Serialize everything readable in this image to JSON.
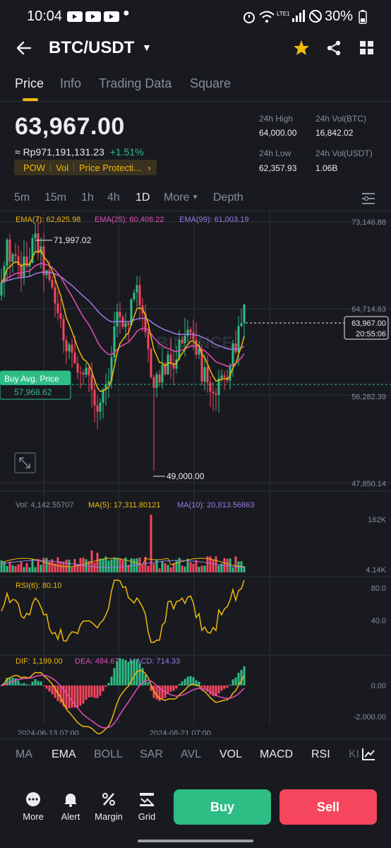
{
  "status_bar": {
    "time": "10:04",
    "battery": "30%",
    "network": "LTE1"
  },
  "header": {
    "pair": "BTC/USDT"
  },
  "tabs": [
    "Price",
    "Info",
    "Trading Data",
    "Square"
  ],
  "ticker": {
    "last_price": "63,967.00",
    "fiat_price": "≈ Rp971,191,131.23",
    "change": "+1.51%",
    "badges": [
      "POW",
      "Vol",
      "Price Protecti..."
    ],
    "high_label": "24h High",
    "high": "64,000.00",
    "low_label": "24h Low",
    "low": "62,357.93",
    "vol_btc_label": "24h Vol(BTC)",
    "vol_btc": "16,842.02",
    "vol_usdt_label": "24h Vol(USDT)",
    "vol_usdt": "1.06B"
  },
  "timeframes": [
    "5m",
    "15m",
    "1h",
    "4h",
    "1D",
    "More",
    "Depth"
  ],
  "chart": {
    "ema7": "EMA(7): 62,625.98",
    "ema25": "EMA(25): 60,408.22",
    "ema99": "EMA(99): 61,003.19",
    "axis": [
      "73,146.88",
      "64,714.63",
      "56,282.39",
      "47,850.14"
    ],
    "high_marker": "71,997.02",
    "low_marker": "49,000.00",
    "current_price": "63,967.00",
    "countdown": "20:55:06",
    "buy_avg_label": "Buy Avg. Price",
    "buy_avg_value": "57,968.62",
    "watermark": "BINANCE",
    "colors": {
      "up": "#2ebd85",
      "down": "#f6465d",
      "ema7": "#f0b90b",
      "ema25": "#e84cb8",
      "ema99": "#9d7be3"
    }
  },
  "volume": {
    "vol": "Vol: 4,142.55707",
    "ma5": "MA(5): 17,311.80121",
    "ma10": "MA(10): 20,813.56863",
    "axis_top": "162K",
    "axis_bottom": "4.14K"
  },
  "rsi": {
    "label": "RSI(6): 80.10",
    "axis_top": "80.0",
    "axis_mid": "40.0"
  },
  "macd": {
    "dif": "DIF: 1,199.00",
    "dea": "DEA: 484.67",
    "macd": "MACD: 714.33",
    "axis_top": "0.00",
    "axis_bottom": "-2,000.00",
    "date1": "2024-06-13 07:00",
    "date2": "2024-08-21 07:00"
  },
  "indicator_tabs": [
    "MA",
    "EMA",
    "BOLL",
    "SAR",
    "AVL",
    "VOL",
    "MACD",
    "RSI",
    "KI"
  ],
  "actions": {
    "nav": [
      "More",
      "Alert",
      "Margin",
      "Grid"
    ],
    "buy": "Buy",
    "sell": "Sell"
  }
}
